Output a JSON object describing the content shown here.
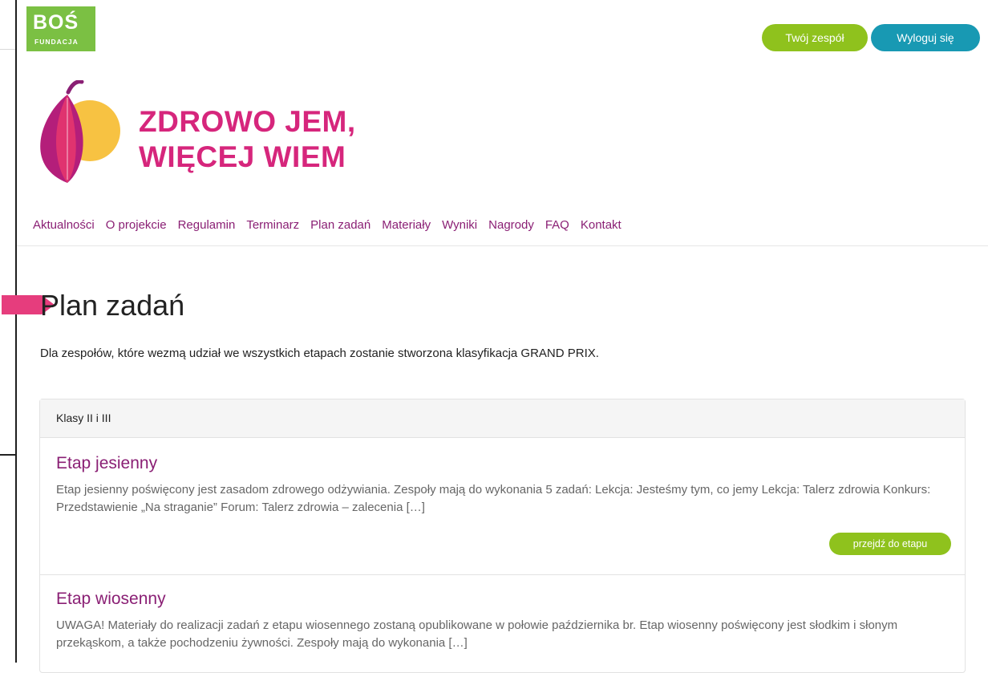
{
  "header": {
    "logo": {
      "main": "BOŚ",
      "sub": "FUNDACJA"
    },
    "buttons": {
      "team": "Twój zespół",
      "logout": "Wyloguj się"
    }
  },
  "brand": {
    "line1": "ZDROWO JEM,",
    "line2": "WIĘCEJ WIEM"
  },
  "nav": [
    "Aktualności",
    "O projekcie",
    "Regulamin",
    "Terminarz",
    "Plan zadań",
    "Materiały",
    "Wyniki",
    "Nagrody",
    "FAQ",
    "Kontakt"
  ],
  "page": {
    "title": "Plan zadań",
    "intro": "Dla zespołów, które wezmą udział we wszystkich etapach zostanie stworzona klasyfikacja GRAND PRIX."
  },
  "panel": {
    "header": "Klasy II i III",
    "items": [
      {
        "title": "Etap jesienny",
        "desc": "Etap jesienny poświęcony jest zasadom zdrowego odżywiania. Zespoły mają do wykonania 5 zadań: Lekcja: Jesteśmy tym, co jemy Lekcja: Talerz zdrowia Konkurs: Przedstawienie „Na straganie” Forum: Talerz zdrowia – zalecenia […]",
        "button": "przejdź do etapu"
      },
      {
        "title": "Etap wiosenny",
        "desc": "UWAGA! Materiały do realizacji zadań z etapu wiosennego zostaną opublikowane w połowie października br.  Etap wiosenny poświęcony jest słodkim i słonym przekąskom, a także pochodzeniu żywności. Zespoły mają do wykonania […]"
      }
    ]
  },
  "colors": {
    "green": "#8fc21d",
    "teal": "#1899b3",
    "magenta": "#d6267c",
    "nav": "#8a1f74"
  }
}
